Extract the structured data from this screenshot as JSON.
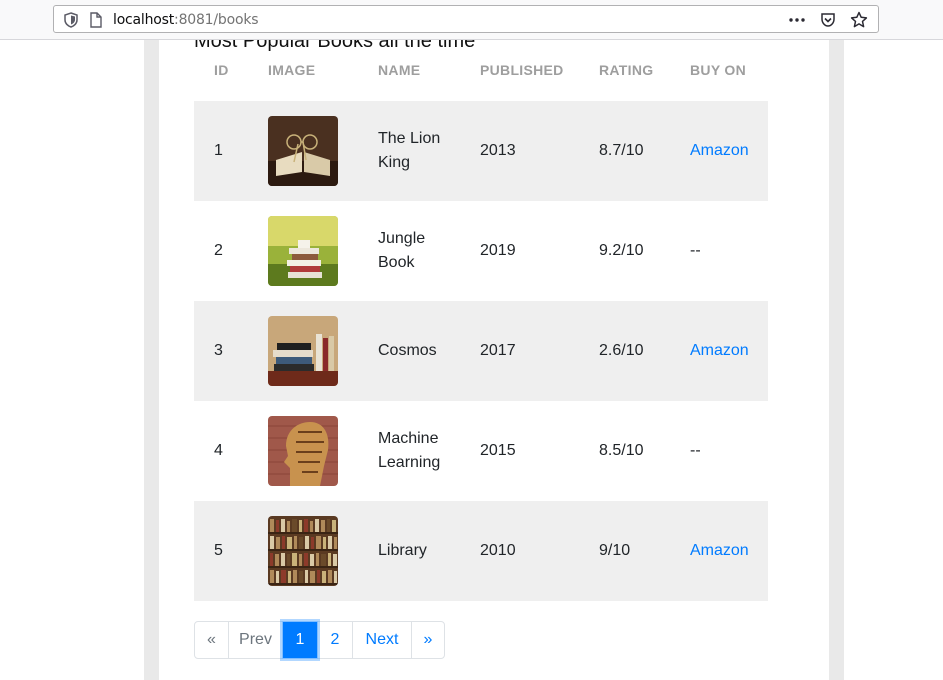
{
  "browser": {
    "url_host": "localhost",
    "url_rest": ":8081/books",
    "icons": [
      "shield-icon",
      "page-icon",
      "more-icon",
      "pocket-icon",
      "bookmark-star-icon"
    ]
  },
  "page": {
    "title": "Most Popular Books all the time"
  },
  "table": {
    "headers": {
      "id": "ID",
      "image": "IMAGE",
      "name": "NAME",
      "published": "PUBLISHED",
      "rating": "RATING",
      "buy_on": "BUY ON"
    },
    "rows": [
      {
        "id": "1",
        "name_line1": "The Lion",
        "name_line2": "King",
        "published": "2013",
        "rating": "8.7/10",
        "buy": "Amazon"
      },
      {
        "id": "2",
        "name_line1": "Jungle",
        "name_line2": "Book",
        "published": "2019",
        "rating": "9.2/10",
        "buy": "--"
      },
      {
        "id": "3",
        "name_line1": "Cosmos",
        "name_line2": "",
        "published": "2017",
        "rating": "2.6/10",
        "buy": "Amazon"
      },
      {
        "id": "4",
        "name_line1": "Machine",
        "name_line2": "Learning",
        "published": "2015",
        "rating": "8.5/10",
        "buy": "--"
      },
      {
        "id": "5",
        "name_line1": "Library",
        "name_line2": "",
        "published": "2010",
        "rating": "9/10",
        "buy": "Amazon"
      }
    ]
  },
  "pagination": {
    "first": "«",
    "prev": "Prev",
    "pages": [
      "1",
      "2"
    ],
    "active_page": "1",
    "next": "Next",
    "last": "»"
  },
  "colors": {
    "link": "#007bff",
    "row_alt": "#efefef",
    "header_text": "#9e9e9e"
  }
}
